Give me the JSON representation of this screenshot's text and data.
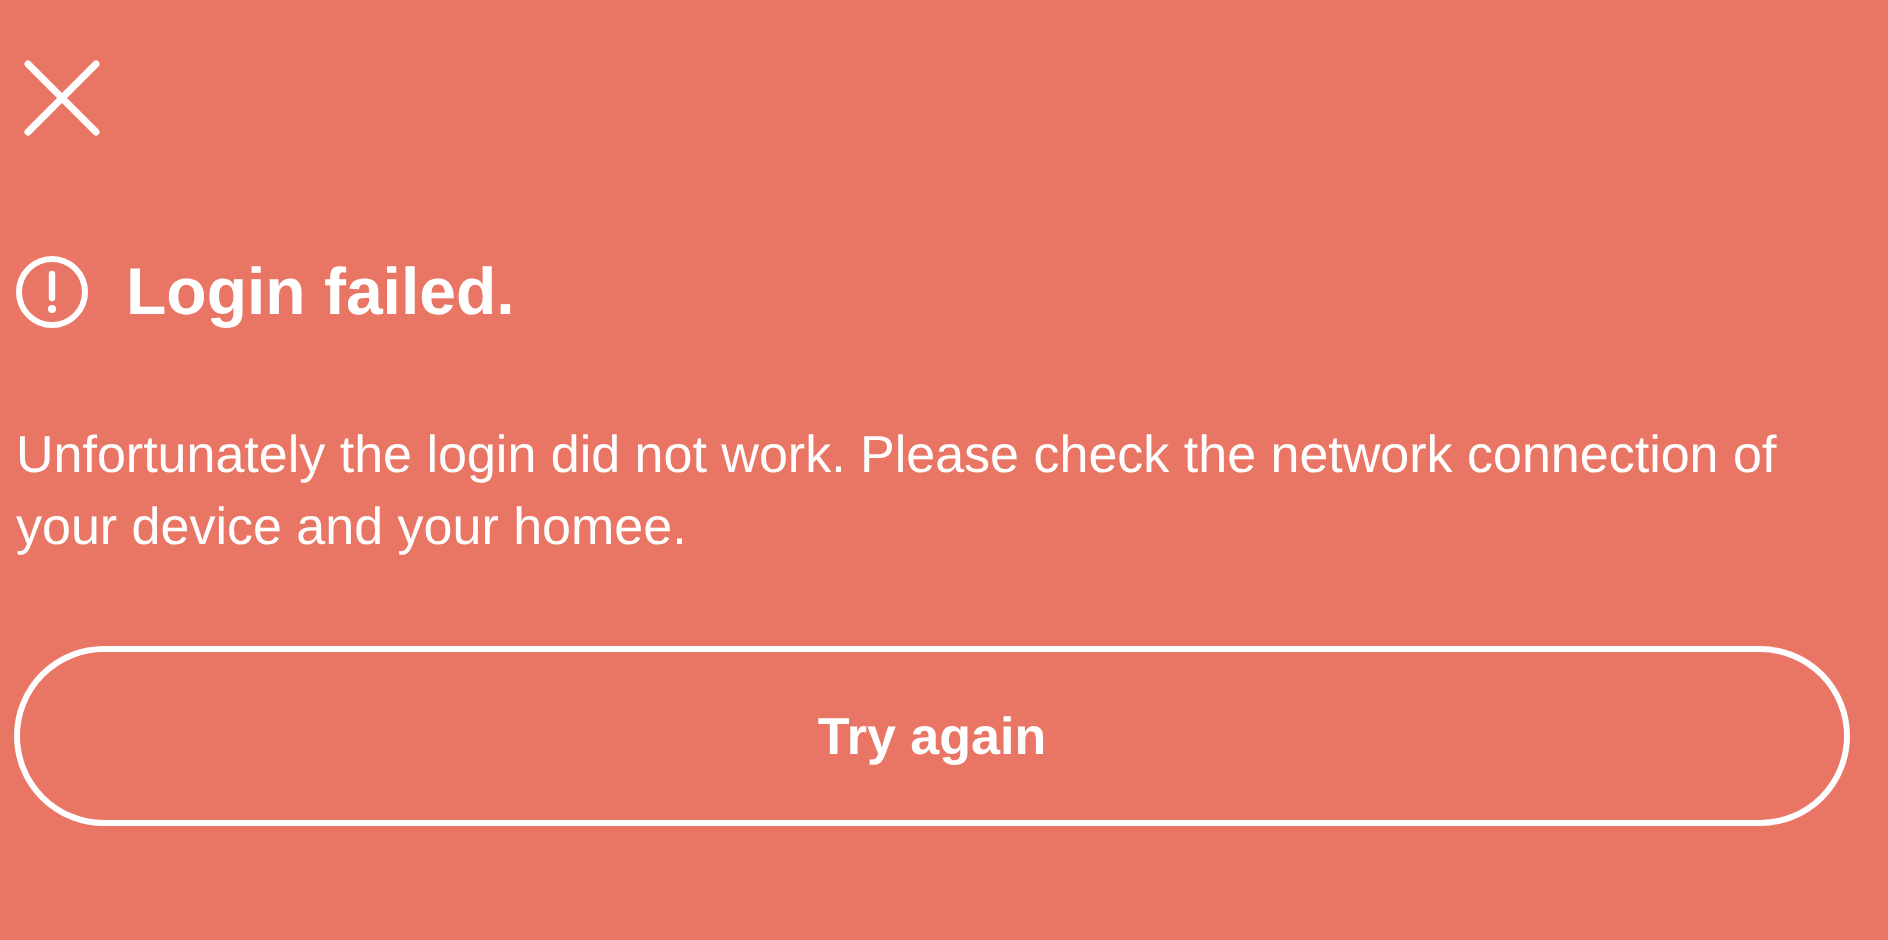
{
  "title": "Login failed.",
  "message": "Unfortunately the login did not work. Please check the network connection of your device and your homee.",
  "button": "Try again"
}
